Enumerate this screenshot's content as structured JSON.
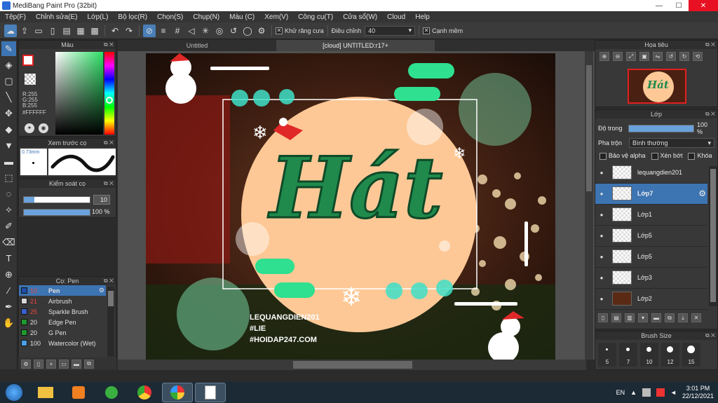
{
  "window": {
    "title": "MediBang Paint Pro (32bit)",
    "minimize": "—",
    "maximize": "☐",
    "close": "✕"
  },
  "menu": [
    "Tệp(F)",
    "Chỉnh sửa(E)",
    "Lớp(L)",
    "Bộ lọc(R)",
    "Chọn(S)",
    "Chụp(N)",
    "Màu (C)",
    "Xem(V)",
    "Công cụ(T)",
    "Cửa sổ(W)",
    "Cloud",
    "Help"
  ],
  "toolbar": {
    "antialias_label": "Khử răng cưa",
    "adjust_label": "Điều chỉnh",
    "adjust_value": "40",
    "sharp_label": "Cạnh mềm"
  },
  "color_panel": {
    "title": "Màu",
    "r": "R:255",
    "g": "G:255",
    "b": "B:255",
    "hex": "#FFFFFF"
  },
  "preview_panel": {
    "title": "Xem trước cọ",
    "size": "0.73mm"
  },
  "control_panel": {
    "title": "Kiểm soát cọ",
    "size_value": "10",
    "opacity_value": "100 %"
  },
  "brush_panel": {
    "title": "Cọ: Pen",
    "items": [
      {
        "size": "10",
        "name": "Pen",
        "color": "#1e4fa8"
      },
      {
        "size": "21",
        "name": "Airbrush",
        "color": "#d8d8d8"
      },
      {
        "size": "25",
        "name": "Sparkle Brush",
        "color": "#3a5fcf"
      },
      {
        "size": "20",
        "name": "Edge Pen",
        "color": "#1f9a2e"
      },
      {
        "size": "20",
        "name": "G Pen",
        "color": "#1f9a2e"
      },
      {
        "size": "100",
        "name": "Watercolor (Wet)",
        "color": "#4aa0e8"
      }
    ]
  },
  "doc_tabs": [
    "Untitled",
    "[cloud] UNTITLED:r17+"
  ],
  "artwork": {
    "title_text": "Hát",
    "credit1": "LEQUANGDIEN201",
    "credit2": "#LIE",
    "credit3": "#HOIDAP247.COM"
  },
  "colors": {
    "accent": "#3d74b2",
    "peach": "#fdc896",
    "green_text": "#1f8a4c",
    "mint": "#2ee08f"
  },
  "nav_panel": {
    "title": "Họa tiêu"
  },
  "layer_panel": {
    "title": "Lớp",
    "opacity_label": "Độ trong",
    "opacity_value": "100 %",
    "opacity_fraction": 1.0,
    "blend_label": "Pha trộn",
    "blend_value": "Bình thường",
    "protect_alpha": "Bảo vệ alpha",
    "clipping": "Xén bớt",
    "lock": "Khóa",
    "layers": [
      "lequangdien201",
      "Lớp7",
      "Lớp1",
      "Lớp5",
      "Lớp5",
      "Lớp3",
      "Lớp2"
    ],
    "selected_index": 1
  },
  "brush_size_panel": {
    "title": "Brush Size",
    "sizes": [
      "5",
      "7",
      "10",
      "12",
      "15"
    ]
  },
  "taskbar": {
    "lang": "EN",
    "time": "3:01 PM",
    "date": "22/12/2021"
  }
}
